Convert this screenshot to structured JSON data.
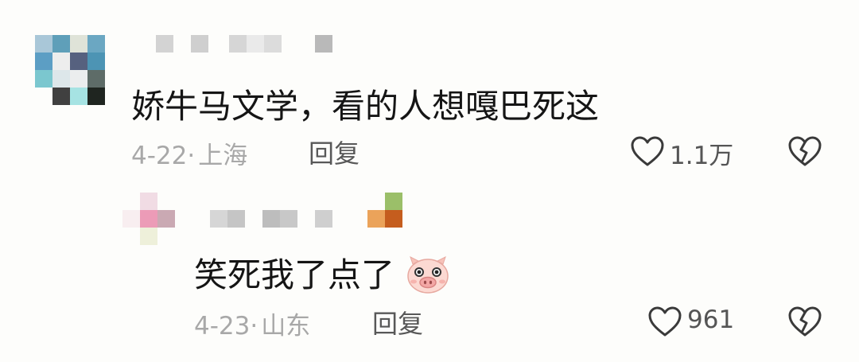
{
  "comments": [
    {
      "text": "娇牛马文学，看的人想嘎巴死这",
      "date": "4-22",
      "location": "上海",
      "reply_label": "回复",
      "likes": "1.1万"
    },
    {
      "text": "笑死我了点了",
      "date": "4-23",
      "location": "山东",
      "reply_label": "回复",
      "likes": "961",
      "emoji": "pig-face-icon"
    }
  ],
  "meta_separator": "·",
  "icons": {
    "like": "heart-outline-icon",
    "dislike": "broken-heart-icon"
  }
}
